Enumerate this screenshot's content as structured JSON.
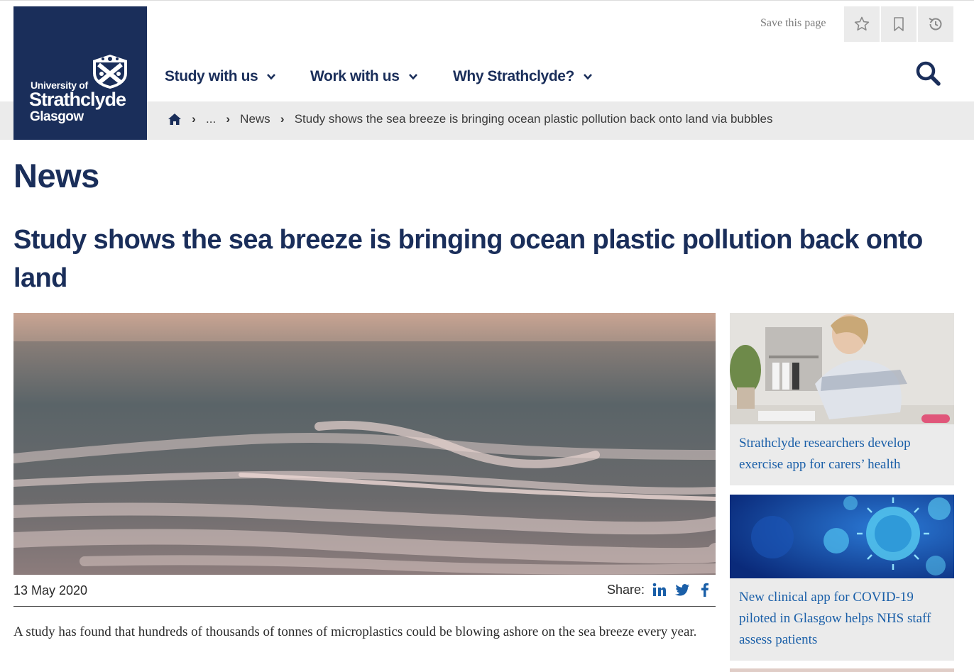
{
  "header": {
    "logo": {
      "line1": "University of",
      "line2": "Strathclyde",
      "line3": "Glasgow"
    },
    "save_label": "Save this page",
    "save_buttons": [
      "star-icon",
      "bookmark-icon",
      "history-icon"
    ],
    "nav": [
      {
        "label": "Study with us"
      },
      {
        "label": "Work with us"
      },
      {
        "label": "Why Strathclyde?"
      }
    ]
  },
  "breadcrumb": {
    "ellipsis": "...",
    "section": "News",
    "current": "Study shows the sea breeze is bringing ocean plastic pollution back onto land via bubbles"
  },
  "page": {
    "title": "News",
    "article_title": "Study shows the sea breeze is bringing ocean plastic pollution back onto land",
    "date": "13 May 2020",
    "share_label": "Share:",
    "lead": "A study has found that hundreds of thousands of tonnes of microplastics could be blowing ashore on the sea breeze every year."
  },
  "sidebar": {
    "cards": [
      {
        "title": "Strathclyde researchers develop exercise app for carers’ health"
      },
      {
        "title": "New clinical app for COVID-19 piloted in Glasgow helps NHS staff assess patients"
      }
    ]
  },
  "colors": {
    "navy": "#1a2e5a",
    "link": "#1a5fa8",
    "panel": "#ebebeb"
  }
}
